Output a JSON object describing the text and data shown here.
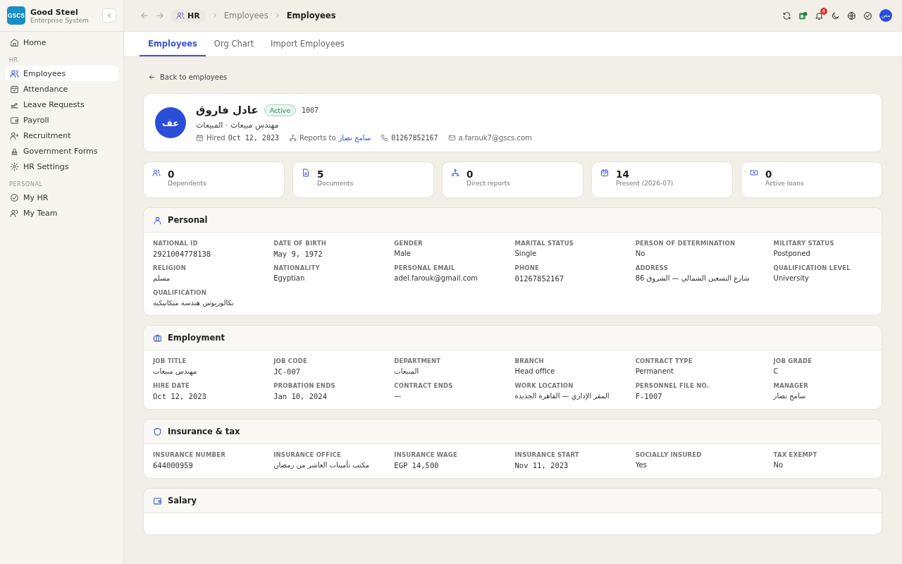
{
  "sidebar": {
    "logo": "GSCS",
    "company": "Good Steel",
    "subtitle": "Enterprise System",
    "groups": [
      {
        "items": [
          {
            "label": "Home",
            "selected": false
          }
        ]
      },
      {
        "heading": "HR",
        "items": [
          {
            "label": "Employees",
            "selected": true
          },
          {
            "label": "Attendance",
            "selected": false
          },
          {
            "label": "Leave Requests",
            "selected": false
          },
          {
            "label": "Payroll",
            "selected": false
          },
          {
            "label": "Recruitment",
            "selected": false
          },
          {
            "label": "Government Forms",
            "selected": false
          },
          {
            "label": "HR Settings",
            "selected": false
          }
        ]
      },
      {
        "heading": "PERSONAL",
        "items": [
          {
            "label": "My HR",
            "selected": false
          },
          {
            "label": "My Team",
            "selected": false
          }
        ]
      }
    ]
  },
  "topbar": {
    "breadcrumb": [
      "HR",
      "Employees",
      "Employees"
    ],
    "notifications": "4",
    "user_initials": "مص"
  },
  "tabs": [
    {
      "label": "Employees",
      "selected": true
    },
    {
      "label": "Org Chart",
      "selected": false
    },
    {
      "label": "Import Employees",
      "selected": false
    }
  ],
  "back_link": "Back to employees",
  "profile": {
    "initials": "عف",
    "name": "عادل فاروق",
    "status": "Active",
    "employee_no": "1007",
    "subtitle": "مهندس مبيعات · المبيعات",
    "hired_label": "Hired",
    "hired": "Oct 12, 2023",
    "reports_label": "Reports to",
    "reports_to": "سامح نصار",
    "phone": "01267852167",
    "email": "a.farouk7@gscs.com"
  },
  "stats": [
    {
      "value": "0",
      "label": "Dependents"
    },
    {
      "value": "5",
      "label": "Documents"
    },
    {
      "value": "0",
      "label": "Direct reports"
    },
    {
      "value": "14",
      "label": "Present (2026-07)"
    },
    {
      "value": "0",
      "label": "Active loans"
    }
  ],
  "sections": [
    {
      "title": "Personal",
      "fields": [
        {
          "label": "NATIONAL ID",
          "value": "2921004778138",
          "kind": "mono"
        },
        {
          "label": "DATE OF BIRTH",
          "value": "May 9, 1972",
          "kind": "mono"
        },
        {
          "label": "GENDER",
          "value": "Male",
          "kind": "text"
        },
        {
          "label": "MARITAL STATUS",
          "value": "Single",
          "kind": "text"
        },
        {
          "label": "PERSON OF DETERMINATION",
          "value": "No",
          "kind": "text"
        },
        {
          "label": "MILITARY STATUS",
          "value": "Postponed",
          "kind": "text"
        },
        {
          "label": "RELIGION",
          "value": "مسلم",
          "kind": "text"
        },
        {
          "label": "NATIONALITY",
          "value": "Egyptian",
          "kind": "text"
        },
        {
          "label": "PERSONAL EMAIL",
          "value": "adel.farouk@gmail.com",
          "kind": "text"
        },
        {
          "label": "PHONE",
          "value": "01267852167",
          "kind": "mono"
        },
        {
          "label": "ADDRESS",
          "value": "شارع التسعين الشمالي — الشروق 86",
          "kind": "text"
        },
        {
          "label": "QUALIFICATION LEVEL",
          "value": "University",
          "kind": "text"
        },
        {
          "label": "QUALIFICATION",
          "value": "بكالوريوس هندسة ميكانيكية",
          "kind": "text"
        }
      ]
    },
    {
      "title": "Employment",
      "fields": [
        {
          "label": "JOB TITLE",
          "value": "مهندس مبيعات",
          "kind": "text"
        },
        {
          "label": "JOB CODE",
          "value": "JC-007",
          "kind": "mono"
        },
        {
          "label": "DEPARTMENT",
          "value": "المبيعات",
          "kind": "text"
        },
        {
          "label": "BRANCH",
          "value": "Head office",
          "kind": "text"
        },
        {
          "label": "CONTRACT TYPE",
          "value": "Permanent",
          "kind": "text"
        },
        {
          "label": "JOB GRADE",
          "value": "C",
          "kind": "text"
        },
        {
          "label": "HIRE DATE",
          "value": "Oct 12, 2023",
          "kind": "mono"
        },
        {
          "label": "PROBATION ENDS",
          "value": "Jan 10, 2024",
          "kind": "mono"
        },
        {
          "label": "CONTRACT ENDS",
          "value": "—",
          "kind": "text"
        },
        {
          "label": "WORK LOCATION",
          "value": "المقر الإداري — القاهرة الجديدة",
          "kind": "text"
        },
        {
          "label": "PERSONNEL FILE NO.",
          "value": "F-1007",
          "kind": "mono"
        },
        {
          "label": "MANAGER",
          "value": "سامح نصار",
          "kind": "link"
        }
      ]
    },
    {
      "title": "Insurance & tax",
      "fields": [
        {
          "label": "INSURANCE NUMBER",
          "value": "644000959",
          "kind": "mono"
        },
        {
          "label": "INSURANCE OFFICE",
          "value": "مكتب تأمينات العاشر من رمضان",
          "kind": "text"
        },
        {
          "label": "INSURANCE WAGE",
          "value": "EGP 14,500",
          "kind": "mono"
        },
        {
          "label": "INSURANCE START",
          "value": "Nov 11, 2023",
          "kind": "mono"
        },
        {
          "label": "SOCIALLY INSURED",
          "value": "Yes",
          "kind": "text"
        },
        {
          "label": "TAX EXEMPT",
          "value": "No",
          "kind": "text"
        }
      ]
    },
    {
      "title": "Salary"
    }
  ]
}
